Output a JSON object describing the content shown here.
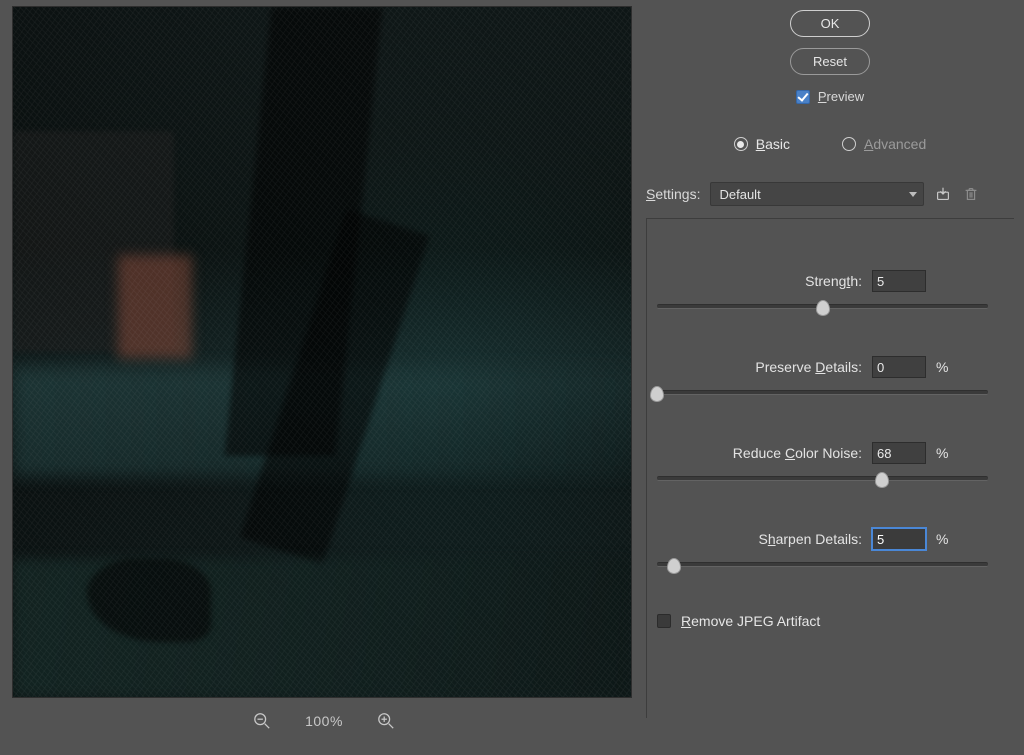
{
  "buttons": {
    "ok": "OK",
    "reset": "Reset"
  },
  "preview": {
    "label_html": "<span class='u'>P</span>review",
    "checked": true
  },
  "mode": {
    "basic_html": "<span class='u'>B</span>asic",
    "advanced_html": "<span class='u'>A</span>dvanced",
    "selected": "basic"
  },
  "settings": {
    "label_html": "<span class='u'>S</span>ettings:",
    "value": "Default"
  },
  "params": {
    "strength": {
      "label_html": "Streng<span class='u'>t</span>h:",
      "value": "5",
      "pos": 50,
      "has_pct": false
    },
    "preserve_details": {
      "label_html": "Preserve <span class='u'>D</span>etails:",
      "value": "0",
      "pos": 0,
      "has_pct": true
    },
    "reduce_color": {
      "label_html": "Reduce <span class='u'>C</span>olor Noise:",
      "value": "68",
      "pos": 68,
      "has_pct": true
    },
    "sharpen_details": {
      "label_html": "S<span class='u'>h</span>arpen Details:",
      "value": "5",
      "pos": 5,
      "has_pct": true,
      "focused": true
    }
  },
  "jpeg": {
    "label_html": "<span class='u'>R</span>emove JPEG Artifact",
    "checked": false
  },
  "zoom": {
    "pct": "100%"
  },
  "pct_symbol": "%"
}
